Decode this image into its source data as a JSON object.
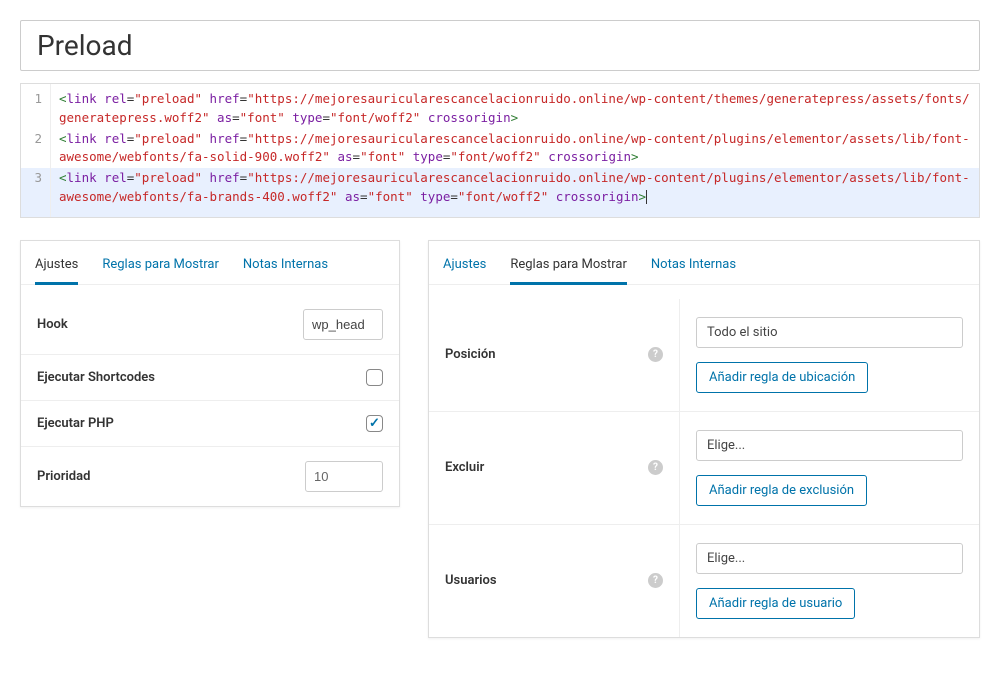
{
  "title": "Preload",
  "code": {
    "lines": [
      {
        "n": 1,
        "selected": false,
        "tokens": {
          "href": "https://mejoresauricularescancelacionruido.online/wp-content/themes/generatepress/assets/fonts/generatepress.woff2",
          "rel": "preload",
          "as": "font",
          "type": "font/woff2",
          "extra": "crossorigin"
        }
      },
      {
        "n": 2,
        "selected": false,
        "tokens": {
          "href": "https://mejoresauricularescancelacionruido.online/wp-content/plugins/elementor/assets/lib/font-awesome/webfonts/fa-solid-900.woff2",
          "rel": "preload",
          "as": "font",
          "type": "font/woff2",
          "extra": "crossorigin"
        }
      },
      {
        "n": 3,
        "selected": true,
        "tokens": {
          "href": "https://mejoresauricularescancelacionruido.online/wp-content/plugins/elementor/assets/lib/font-awesome/webfonts/fa-brands-400.woff2",
          "rel": "preload",
          "as": "font",
          "type": "font/woff2",
          "extra": "crossorigin"
        }
      }
    ]
  },
  "panel_a": {
    "tabs": {
      "settings": "Ajustes",
      "rules": "Reglas para Mostrar",
      "notes": "Notas Internas"
    },
    "active_tab": "settings",
    "rows": {
      "hook_label": "Hook",
      "hook_value": "wp_head",
      "shortcodes_label": "Ejecutar Shortcodes",
      "shortcodes_checked": false,
      "php_label": "Ejecutar PHP",
      "php_checked": true,
      "priority_label": "Prioridad",
      "priority_value": "10"
    }
  },
  "panel_b": {
    "tabs": {
      "settings": "Ajustes",
      "rules": "Reglas para Mostrar",
      "notes": "Notas Internas"
    },
    "active_tab": "rules",
    "rows": {
      "position_label": "Posición",
      "position_value": "Todo el sitio",
      "position_btn": "Añadir regla de ubicación",
      "exclude_label": "Excluir",
      "exclude_value": "Elige...",
      "exclude_btn": "Añadir regla de exclusión",
      "users_label": "Usuarios",
      "users_value": "Elige...",
      "users_btn": "Añadir regla de usuario"
    }
  }
}
